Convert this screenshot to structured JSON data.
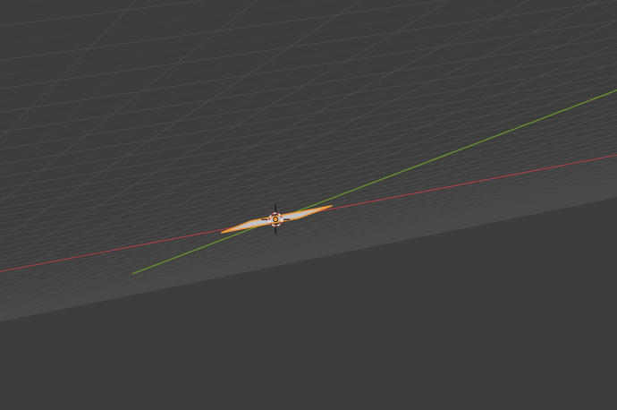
{
  "viewport": {
    "view": "perspective",
    "background_color": "#3d3d3d",
    "grid_color": "#4a4a4a",
    "grid_subdivision_color": "#434343",
    "x_axis_color": "#a8424a",
    "y_axis_color": "#6b9a2c"
  },
  "object": {
    "type": "plane",
    "selected": true,
    "fill_color": "#c1c3c9",
    "outline_color": "#f09a3a"
  },
  "cursor_3d": {
    "ring_color_a": "#c33a3a",
    "ring_color_b": "#f0f0f0",
    "crosshair_color": "#111111",
    "origin_color": "#f09a3a"
  }
}
